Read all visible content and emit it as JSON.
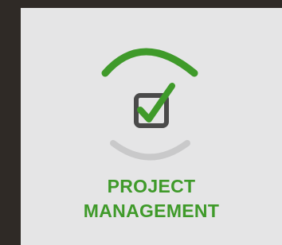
{
  "tile": {
    "title_line1": "PROJECT",
    "title_line2": "MANAGEMENT",
    "icon": "checkbox-checkmark-icon",
    "colors": {
      "background": "#e5e5e6",
      "frame": "#2f2a26",
      "accent_green": "#3f9a2a",
      "checkbox_gray": "#4a4a4a",
      "arc_gray": "#c9c9ca"
    }
  }
}
